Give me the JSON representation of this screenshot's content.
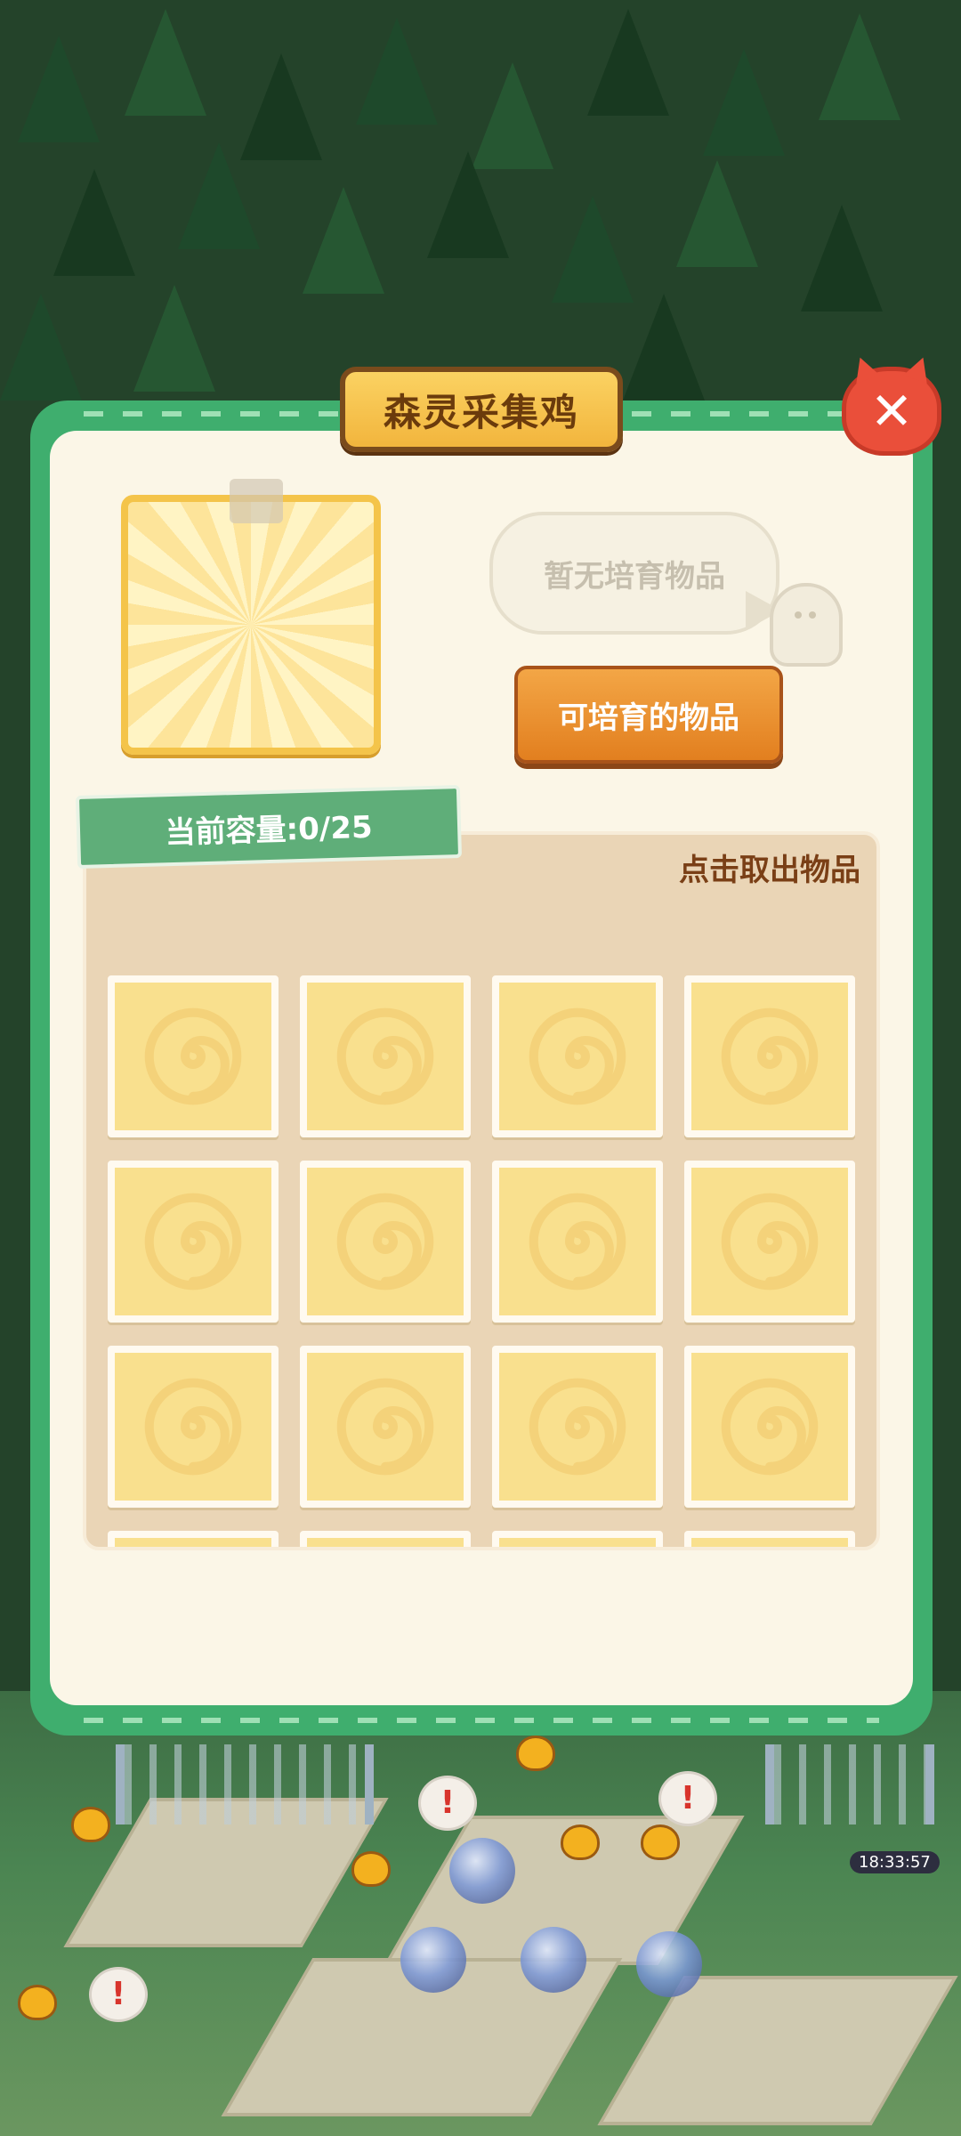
{
  "dialog": {
    "title": "森灵采集鸡",
    "close_icon": "close-icon",
    "speech": "暂无培育物品",
    "breedable_button": "可培育的物品",
    "capacity_label": "当前容量:0/25",
    "take_out_hint": "点击取出物品",
    "slots": [
      {
        "state": "empty",
        "icon": "swirl-icon"
      },
      {
        "state": "empty",
        "icon": "swirl-icon"
      },
      {
        "state": "empty",
        "icon": "swirl-icon"
      },
      {
        "state": "empty",
        "icon": "swirl-icon"
      },
      {
        "state": "empty",
        "icon": "swirl-icon"
      },
      {
        "state": "empty",
        "icon": "swirl-icon"
      },
      {
        "state": "empty",
        "icon": "swirl-icon"
      },
      {
        "state": "empty",
        "icon": "swirl-icon"
      },
      {
        "state": "empty",
        "icon": "swirl-icon"
      },
      {
        "state": "empty",
        "icon": "swirl-icon"
      },
      {
        "state": "empty",
        "icon": "swirl-icon"
      },
      {
        "state": "empty",
        "icon": "swirl-icon"
      },
      {
        "state": "empty",
        "icon": "swirl-icon"
      },
      {
        "state": "empty",
        "icon": "swirl-icon"
      },
      {
        "state": "empty",
        "icon": "swirl-icon"
      },
      {
        "state": "empty",
        "icon": "swirl-icon"
      }
    ]
  },
  "background": {
    "timer": "18:33:57"
  },
  "colors": {
    "frame_green": "#3fae6e",
    "panel_cream": "#fbf6e7",
    "title_gold": "#f2b53d",
    "button_orange": "#e27f1f",
    "close_red": "#ea4f3a",
    "slot_yellow": "#f9e08e"
  }
}
